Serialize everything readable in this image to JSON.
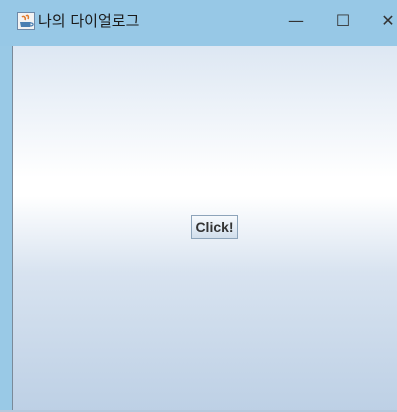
{
  "window": {
    "title": "나의 다이얼로그",
    "app_icon": "java-cup-icon",
    "controls": {
      "minimize_icon": "minimize-icon",
      "minimize_glyph": "—",
      "maximize_icon": "maximize-icon",
      "maximize_glyph": "☐",
      "close_icon": "close-icon",
      "close_glyph": "✕"
    }
  },
  "content": {
    "button_label": "Click!"
  },
  "colors": {
    "titlebar": "#97c8e6",
    "content_top": "#dde7f3",
    "content_bottom": "#bdd0e5"
  }
}
